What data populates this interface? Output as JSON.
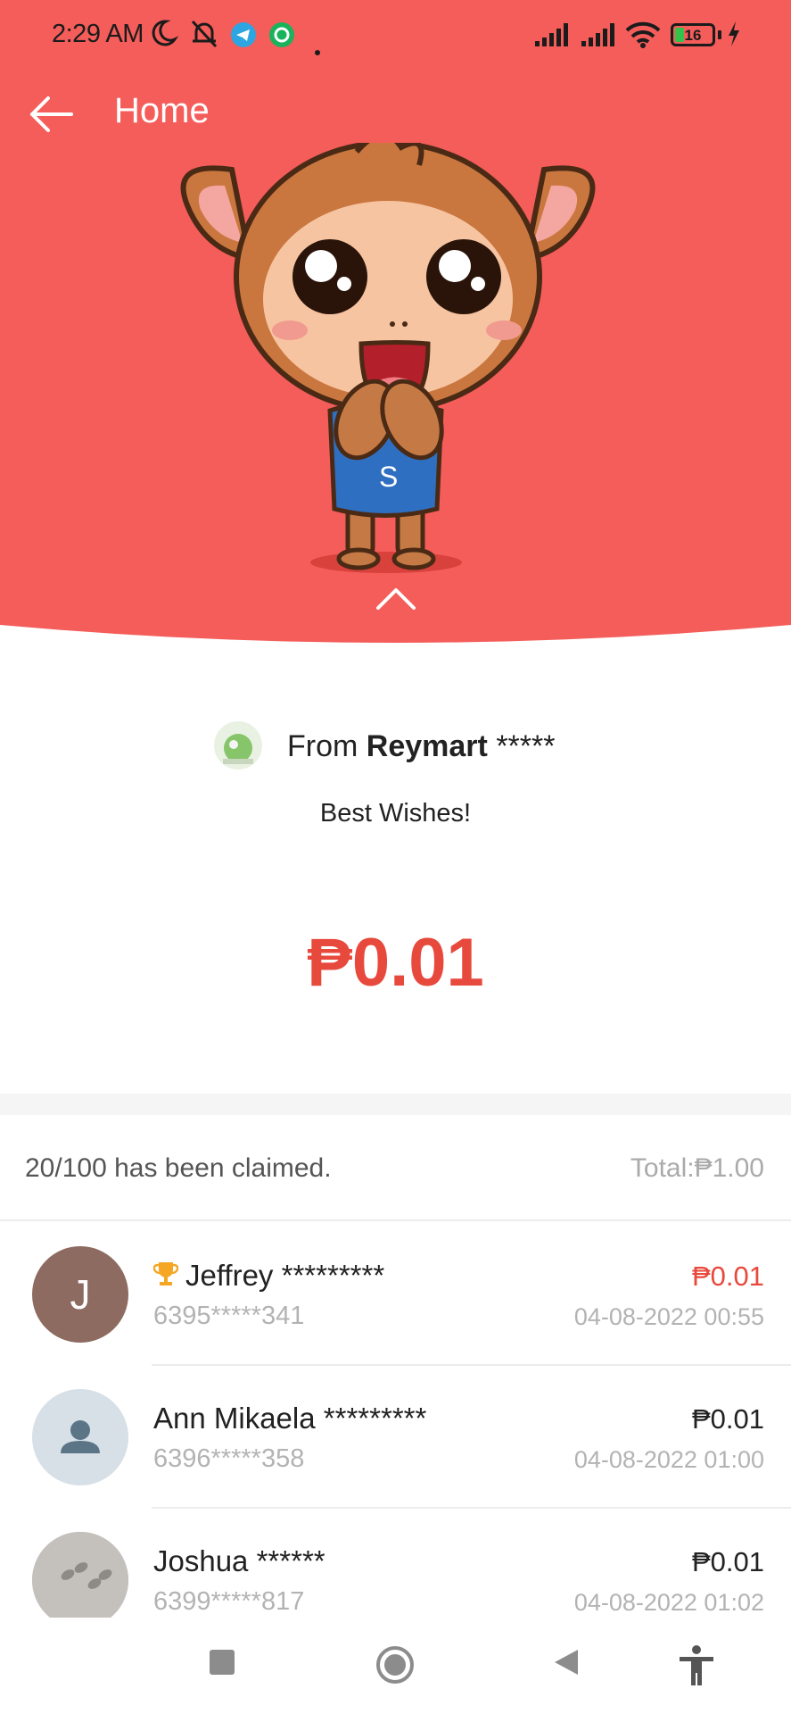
{
  "status_bar": {
    "time": "2:29 AM",
    "battery": "16",
    "icons": [
      "moon-icon",
      "bell-off-icon",
      "telegram-icon",
      "whatsapp-icon",
      "dot-icon",
      "signal-icon",
      "signal-icon",
      "wifi-icon",
      "battery-icon",
      "bolt-icon"
    ]
  },
  "header": {
    "title": "Home",
    "back_icon": "arrow-left-icon",
    "collapse_icon": "chevron-up-icon",
    "background": "#f45d5a"
  },
  "packet": {
    "from_prefix": "From",
    "sender_name": "Reymart",
    "sender_mask": "*****",
    "message": "Best Wishes!",
    "amount": "₱0.01",
    "amount_color": "#e8493d"
  },
  "summary": {
    "claimed": "20/100 has been claimed.",
    "total": "Total:₱1.00"
  },
  "claims": [
    {
      "avatar_type": "letter",
      "initial": "J",
      "top_claimer": true,
      "name": "Jeffrey *********",
      "phone": "6395*****341",
      "amount": "₱0.01",
      "datetime": "04-08-2022 00:55"
    },
    {
      "avatar_type": "person",
      "initial": "",
      "top_claimer": false,
      "name": "Ann Mikaela *********",
      "phone": "6396*****358",
      "amount": "₱0.01",
      "datetime": "04-08-2022 01:00"
    },
    {
      "avatar_type": "photo",
      "initial": "",
      "top_claimer": false,
      "name": "Joshua ******",
      "phone": "6399*****817",
      "amount": "₱0.01",
      "datetime": "04-08-2022 01:02"
    }
  ],
  "navbar": {
    "icons": [
      "recents-icon",
      "home-icon",
      "back-icon",
      "accessibility-icon"
    ]
  }
}
